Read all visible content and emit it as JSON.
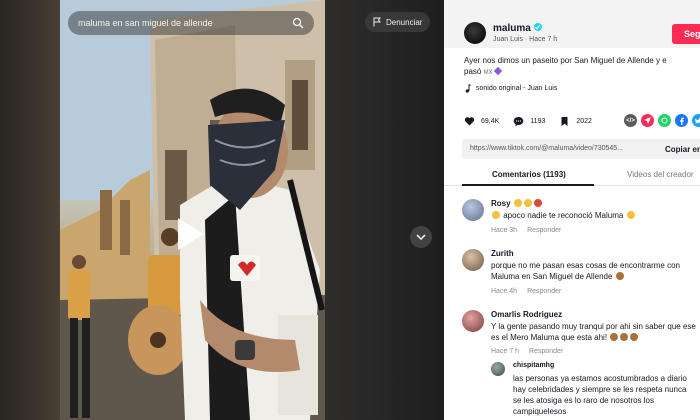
{
  "search": {
    "query": "maluma en san miguel de allende"
  },
  "report": {
    "label": "Denunciar"
  },
  "post": {
    "author": "maluma",
    "author_sub": "Juan Luis · Hace 7 h",
    "follow_label": "Seg",
    "caption": "Ayer nos dimos un paseito por San Miguel de Allende y e",
    "caption_line2": "pasó",
    "caption_tag": "MX",
    "sound": "sonido original - Juan Luis"
  },
  "stats": {
    "likes": "69,4K",
    "comments": "1193",
    "saves": "2022"
  },
  "share": {
    "embed_label": "</>"
  },
  "link": {
    "url": "https://www.tiktok.com/@maluma/video/730545...",
    "copy_label": "Copiar en"
  },
  "tabs": {
    "comments": "Comentarios (1193)",
    "creator_videos": "Videos del creador"
  },
  "comments": [
    {
      "name": "Rosy",
      "text": "apoco nadie te reconoció Maluma",
      "time": "Hace 3h",
      "reply": "Responder"
    },
    {
      "name": "Zurith",
      "text": "porque no me pasan esas cosas de encontrarme con Maluma en San Miguel de Allende",
      "time": "Hace 4h",
      "reply": "Responder"
    },
    {
      "name": "Omarlis Rodriguez",
      "text": "Y la gente pasando muy tranqui por ahi sin saber que ese es el Mero Maluma que esta ahi!",
      "time": "Hace 7 h",
      "reply": "Responder"
    },
    {
      "name": "chispitamhg",
      "text": "las personas ya estamos acostumbrados a diario hay celebridades y siempre se les respeta nunca se les atosiga es lo raro de nosotros los campiquelesos"
    }
  ],
  "colors": {
    "follow": "#fe2c55",
    "verified": "#20d5ec",
    "panel_bg": "#ffffff",
    "stage_bg": "#1b1b1b"
  },
  "icons": [
    "search-icon",
    "flag-icon",
    "play-icon",
    "chevron-down-icon",
    "heart-icon",
    "comment-icon",
    "bookmark-icon",
    "music-note-icon"
  ]
}
